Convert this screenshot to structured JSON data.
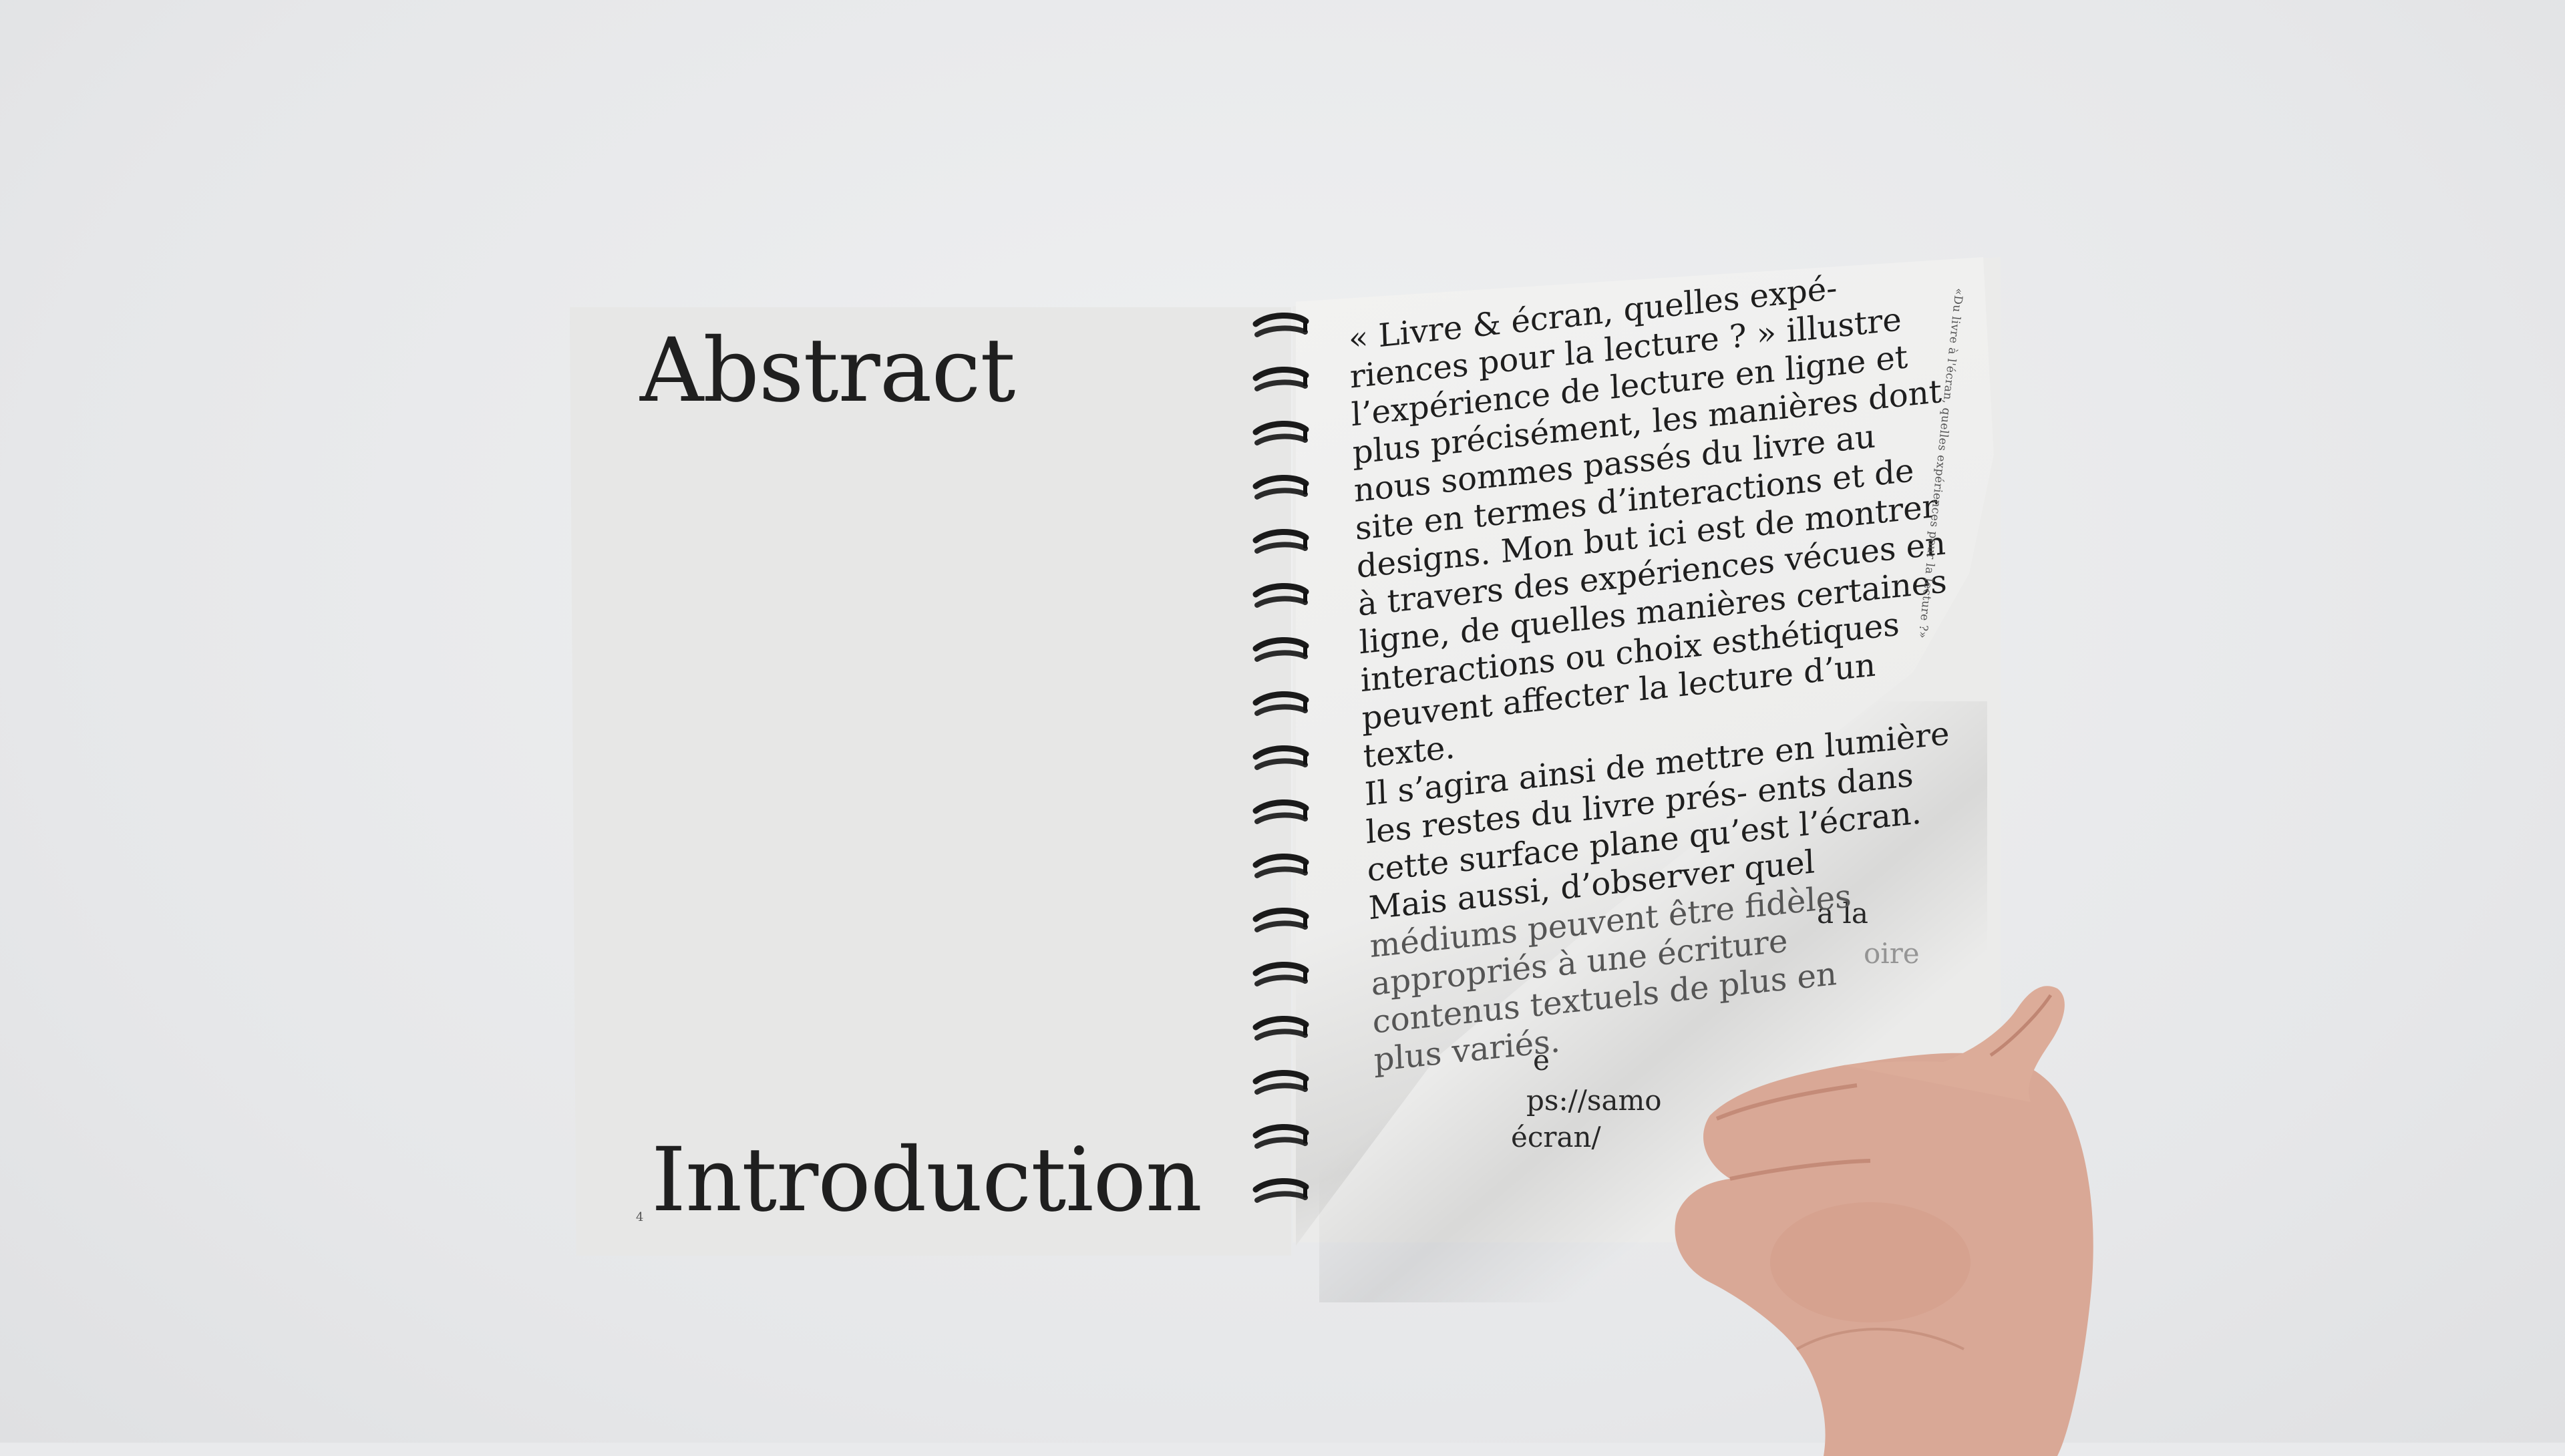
{
  "left_page": {
    "heading_top": "Abstract",
    "heading_bottom": "Introduction",
    "page_number": "4"
  },
  "right_page": {
    "running_head": "«Du livre à l'écran, quelles expériences pour la lecture ?»",
    "body_lines": [
      "« Livre & écran, quelles  expé-",
      "riences pour la lecture ? » illustre",
      "l’expérience de lecture en ligne et",
      "plus précisément, les manières dont",
      "nous sommes passés du livre au",
      "site en termes d’interactions et de",
      "designs. Mon but ici est de montrer",
      "à travers des expériences vécues en",
      "ligne, de quelles manières certaines",
      "interactions ou choix esthétiques",
      "peuvent affecter la lecture d’un",
      "texte.",
      "Il s’agira ainsi de mettre en lumière",
      "les restes du livre prés- ents dans",
      "cette surface plane qu’est l’écran.",
      "Mais aussi, d’observer quel",
      "médiums peuvent être fidèles",
      "appropriés à une écriture",
      "contenus textuels de plus en",
      "plus variés."
    ],
    "underneath_lines": [
      "a la",
      "oire",
      "ps://samo",
      "écran/",
      "e"
    ]
  }
}
